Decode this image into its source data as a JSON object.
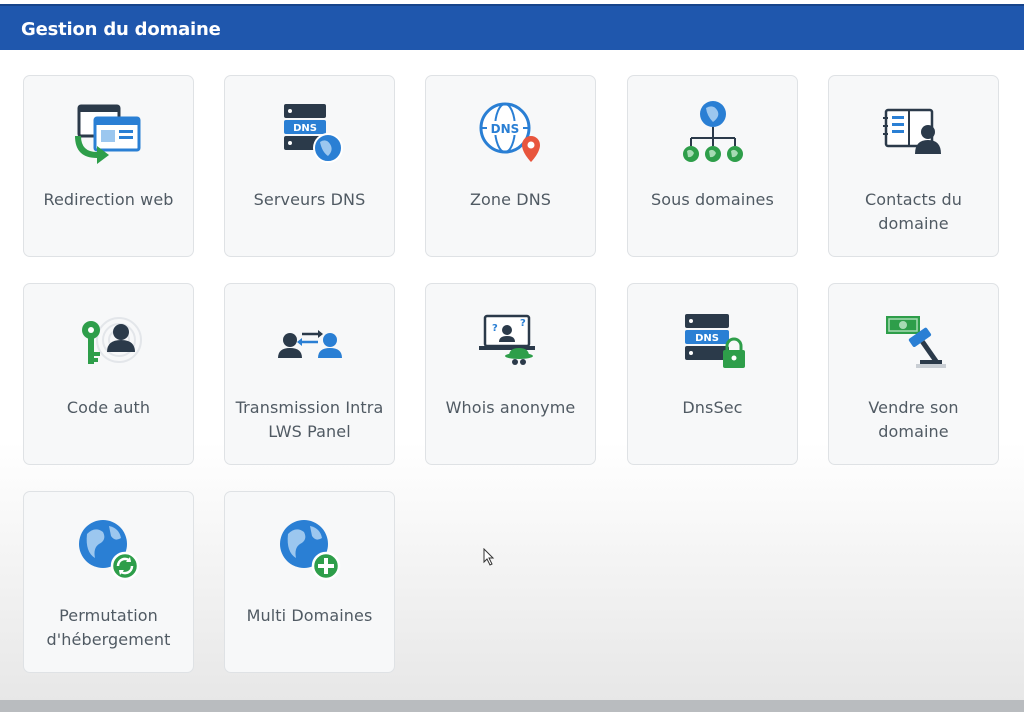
{
  "header": {
    "title": "Gestion du domaine"
  },
  "tiles": [
    {
      "label": "Redirection web",
      "icon": "redirect-icon"
    },
    {
      "label": "Serveurs DNS",
      "icon": "dns-server-icon"
    },
    {
      "label": "Zone DNS",
      "icon": "dns-zone-icon"
    },
    {
      "label": "Sous domaines",
      "icon": "subdomains-icon"
    },
    {
      "label": "Contacts du domaine",
      "icon": "contacts-icon"
    },
    {
      "label": "Code auth",
      "icon": "auth-code-icon"
    },
    {
      "label": "Transmission Intra LWS Panel",
      "icon": "transfer-icon"
    },
    {
      "label": "Whois anonyme",
      "icon": "whois-anonymous-icon"
    },
    {
      "label": "DnsSec",
      "icon": "dnssec-icon"
    },
    {
      "label": "Vendre son domaine",
      "icon": "sell-domain-icon"
    },
    {
      "label": "Permutation d'hébergement",
      "icon": "hosting-swap-icon"
    },
    {
      "label": "Multi Domaines",
      "icon": "multi-domains-icon"
    }
  ],
  "colors": {
    "header": "#1f57ad",
    "accent_green": "#2e9e4a",
    "accent_blue": "#2a7fd4"
  }
}
